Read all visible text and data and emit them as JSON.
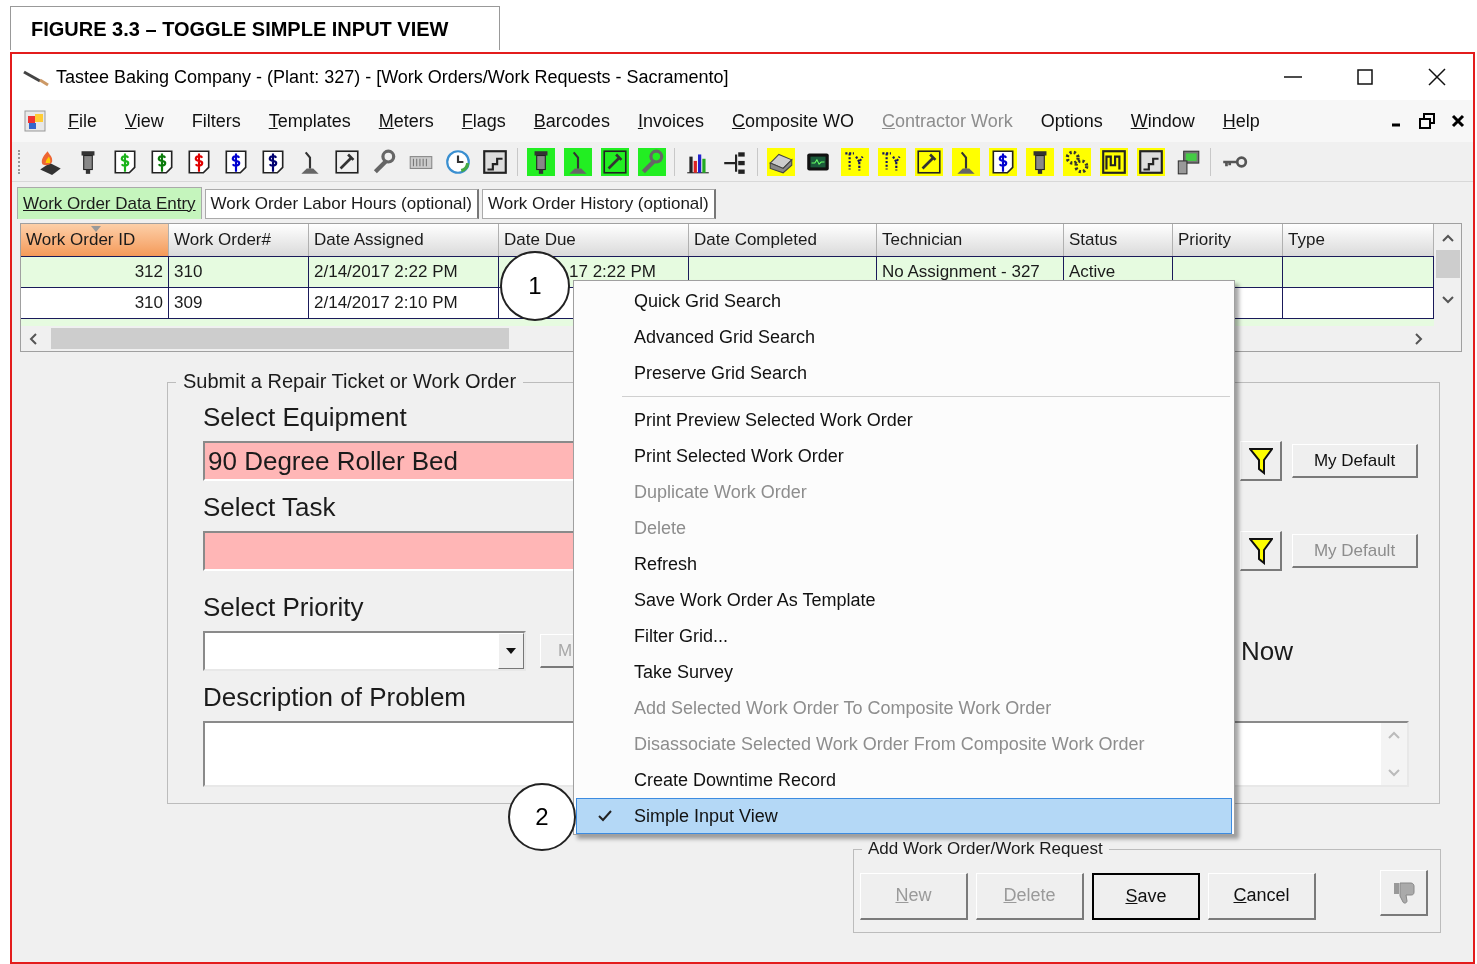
{
  "caption": "FIGURE 3.3 – TOGGLE SIMPLE INPUT VIEW",
  "window": {
    "title": "Tastee Baking Company - (Plant: 327) - [Work Orders/Work Requests - Sacramento]"
  },
  "menu": [
    {
      "label": "File",
      "access_key_underlined": true,
      "disabled": false
    },
    {
      "label": "View",
      "access_key_underlined": true,
      "disabled": false
    },
    {
      "label": "Filters",
      "access_key_underlined": false,
      "disabled": false
    },
    {
      "label": "Templates",
      "access_key_underlined": true,
      "disabled": false
    },
    {
      "label": "Meters",
      "access_key_underlined": true,
      "disabled": false
    },
    {
      "label": "Flags",
      "access_key_underlined": true,
      "disabled": false
    },
    {
      "label": "Barcodes",
      "access_key_underlined": true,
      "disabled": false
    },
    {
      "label": "Invoices",
      "access_key_underlined": true,
      "disabled": false
    },
    {
      "label": "Composite WO",
      "access_key_underlined": true,
      "disabled": false
    },
    {
      "label": "Contractor Work",
      "access_key_underlined": true,
      "disabled": true
    },
    {
      "label": "Options",
      "access_key_underlined": false,
      "disabled": false
    },
    {
      "label": "Window",
      "access_key_underlined": true,
      "disabled": false
    },
    {
      "label": "Help",
      "access_key_underlined": true,
      "disabled": false
    }
  ],
  "tabs": [
    {
      "label": "Work Order Data Entry",
      "selected": true
    },
    {
      "label": "Work Order Labor Hours (optional)",
      "selected": false
    },
    {
      "label": "Work Order History (optional)",
      "selected": false
    }
  ],
  "grid": {
    "columns": [
      {
        "label": "Work Order ID",
        "sorted": true
      },
      {
        "label": "Work Order#",
        "sorted": false
      },
      {
        "label": "Date Assigned",
        "sorted": false
      },
      {
        "label": "Date Due",
        "sorted": false
      },
      {
        "label": "Date Completed",
        "sorted": false
      },
      {
        "label": "Technician",
        "sorted": false
      },
      {
        "label": "Status",
        "sorted": false
      },
      {
        "label": "Priority",
        "sorted": false
      },
      {
        "label": "Type",
        "sorted": false
      }
    ],
    "rows": [
      {
        "cells": [
          "312",
          "310",
          "2/14/2017 2:22 PM",
          "17 2:22 PM",
          null,
          "No Assignment - 327",
          "Active",
          null,
          null
        ]
      },
      {
        "cells": [
          "310",
          "309",
          "2/14/2017 2:10 PM",
          null,
          null,
          null,
          null,
          null,
          null
        ]
      }
    ]
  },
  "form": {
    "title": "Submit a Repair Ticket or Work Order",
    "fields": [
      {
        "kind": "text",
        "label": "Select Equipment",
        "value": "90 Degree Roller Bed",
        "required": true,
        "default_button": {
          "label": "My Default",
          "disabled": false
        }
      },
      {
        "kind": "text",
        "label": "Select Task",
        "required": true,
        "default_button": {
          "label": "My Default",
          "disabled": true
        }
      },
      {
        "kind": "dropdown",
        "label": "Select Priority",
        "required": false,
        "side_button": {
          "label": "M",
          "disabled": true
        },
        "side_label": "Now"
      },
      {
        "kind": "textarea",
        "label": "Description of Problem",
        "required": false
      }
    ]
  },
  "add_group": {
    "title": "Add Work Order/Work Request",
    "buttons": [
      {
        "label": "New",
        "access_key_underlined": true,
        "disabled": true,
        "default": false
      },
      {
        "label": "Delete",
        "access_key_underlined": true,
        "disabled": true,
        "default": false
      },
      {
        "label": "Save",
        "access_key_underlined": true,
        "disabled": false,
        "default": true
      },
      {
        "label": "Cancel",
        "access_key_underlined": true,
        "disabled": false,
        "default": false
      }
    ]
  },
  "context_menu": [
    {
      "kind": "item",
      "label": "Quick Grid Search",
      "disabled": false,
      "checked": false,
      "selected": false
    },
    {
      "kind": "item",
      "label": "Advanced Grid Search",
      "disabled": false,
      "checked": false,
      "selected": false
    },
    {
      "kind": "item",
      "label": "Preserve Grid Search",
      "disabled": false,
      "checked": false,
      "selected": false
    },
    {
      "kind": "separator"
    },
    {
      "kind": "item",
      "label": "Print Preview Selected Work Order",
      "disabled": false,
      "checked": false,
      "selected": false
    },
    {
      "kind": "item",
      "label": "Print Selected Work Order",
      "disabled": false,
      "checked": false,
      "selected": false
    },
    {
      "kind": "item",
      "label": "Duplicate Work Order",
      "disabled": true,
      "checked": false,
      "selected": false
    },
    {
      "kind": "item",
      "label": "Delete",
      "disabled": true,
      "checked": false,
      "selected": false
    },
    {
      "kind": "item",
      "label": "Refresh",
      "disabled": false,
      "checked": false,
      "selected": false
    },
    {
      "kind": "item",
      "label": "Save Work Order As Template",
      "disabled": false,
      "checked": false,
      "selected": false
    },
    {
      "kind": "item",
      "label": "Filter Grid...",
      "disabled": false,
      "checked": false,
      "selected": false
    },
    {
      "kind": "item",
      "label": "Take Survey",
      "disabled": false,
      "checked": false,
      "selected": false
    },
    {
      "kind": "item",
      "label": "Add Selected Work Order To Composite Work Order",
      "disabled": true,
      "checked": false,
      "selected": false
    },
    {
      "kind": "item",
      "label": "Disassociate Selected Work Order From Composite Work Order",
      "disabled": true,
      "checked": false,
      "selected": false
    },
    {
      "kind": "item",
      "label": "Create Downtime Record",
      "disabled": false,
      "checked": false,
      "selected": false
    },
    {
      "kind": "item",
      "label": "Simple Input View",
      "disabled": false,
      "checked": true,
      "selected": true
    }
  ],
  "callouts": [
    {
      "label": "1"
    },
    {
      "label": "2"
    }
  ]
}
